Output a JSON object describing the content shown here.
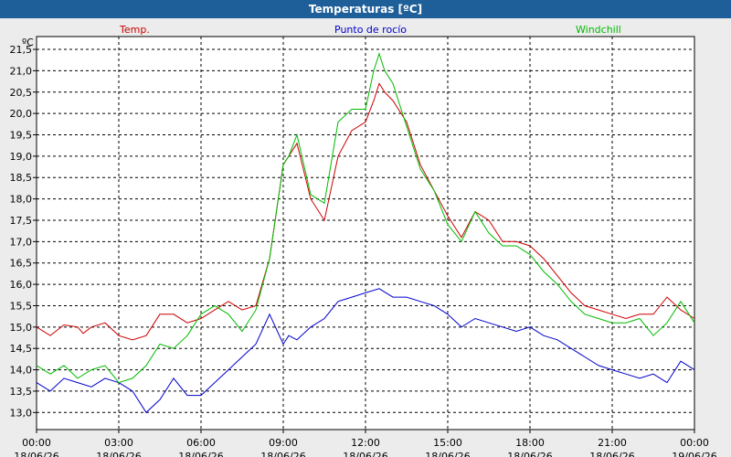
{
  "window": {
    "title": "Temperaturas [ºC]"
  },
  "colors": {
    "temp": "#cc0000",
    "dew": "#0000cc",
    "windchill": "#00bb00",
    "grid": "#000000",
    "background": "#ffffff"
  },
  "chart_data": {
    "type": "line",
    "unit_label": "ºC",
    "ylim": [
      12.6,
      21.8
    ],
    "ticks_y": [
      "13,0",
      "13,5",
      "14,0",
      "14,5",
      "15,0",
      "15,5",
      "16,0",
      "16,5",
      "17,0",
      "17,5",
      "18,0",
      "18,5",
      "19,0",
      "19,5",
      "20,0",
      "20,5",
      "21,0",
      "21,5"
    ],
    "ticks_y_values": [
      13.0,
      13.5,
      14.0,
      14.5,
      15.0,
      15.5,
      16.0,
      16.5,
      17.0,
      17.5,
      18.0,
      18.5,
      19.0,
      19.5,
      20.0,
      20.5,
      21.0,
      21.5
    ],
    "x_hours_range": [
      0,
      24
    ],
    "ticks_x": [
      {
        "hour": 0,
        "time": "00:00",
        "date": "18/06/26"
      },
      {
        "hour": 3,
        "time": "03:00",
        "date": "18/06/26"
      },
      {
        "hour": 6,
        "time": "06:00",
        "date": "18/06/26"
      },
      {
        "hour": 9,
        "time": "09:00",
        "date": "18/06/26"
      },
      {
        "hour": 12,
        "time": "12:00",
        "date": "18/06/26"
      },
      {
        "hour": 15,
        "time": "15:00",
        "date": "18/06/26"
      },
      {
        "hour": 18,
        "time": "18:00",
        "date": "18/06/26"
      },
      {
        "hour": 21,
        "time": "21:00",
        "date": "18/06/26"
      },
      {
        "hour": 24,
        "time": "00:00",
        "date": "19/06/26"
      }
    ],
    "grid": true,
    "legend_placement": "top",
    "series": [
      {
        "name": "Temp.",
        "color": "#cc0000",
        "x": [
          0,
          0.5,
          1,
          1.5,
          1.7,
          2,
          2.5,
          3,
          3.5,
          4,
          4.5,
          5,
          5.5,
          6,
          6.5,
          7,
          7.5,
          8,
          8.5,
          9,
          9.2,
          9.5,
          10,
          10.5,
          11,
          11.5,
          12,
          12.3,
          12.5,
          12.7,
          13,
          13.5,
          14,
          14.5,
          15,
          15.5,
          16,
          16.5,
          17,
          17.5,
          18,
          18.5,
          19,
          19.5,
          20,
          20.5,
          21,
          21.5,
          22,
          22.5,
          23,
          23.5,
          24
        ],
        "values": [
          15.0,
          14.8,
          15.05,
          15.0,
          14.85,
          15.0,
          15.1,
          14.8,
          14.7,
          14.8,
          15.3,
          15.3,
          15.1,
          15.2,
          15.4,
          15.6,
          15.4,
          15.5,
          16.6,
          18.8,
          19.0,
          19.3,
          18.0,
          17.5,
          19.0,
          19.6,
          19.8,
          20.3,
          20.7,
          20.5,
          20.3,
          19.8,
          18.8,
          18.2,
          17.6,
          17.1,
          17.7,
          17.5,
          17.0,
          17.0,
          16.9,
          16.6,
          16.2,
          15.8,
          15.5,
          15.4,
          15.3,
          15.2,
          15.3,
          15.3,
          15.7,
          15.4,
          15.2
        ]
      },
      {
        "name": "Punto de rocío",
        "color": "#0000cc",
        "x": [
          0,
          0.5,
          1,
          1.5,
          2,
          2.5,
          3,
          3.5,
          4,
          4.5,
          5,
          5.5,
          6,
          6.5,
          7,
          7.5,
          8,
          8.5,
          9,
          9.2,
          9.5,
          10,
          10.5,
          11,
          11.5,
          12,
          12.5,
          13,
          13.5,
          14,
          14.5,
          15,
          15.5,
          16,
          16.5,
          17,
          17.5,
          18,
          18.5,
          19,
          19.5,
          20,
          20.5,
          21,
          21.5,
          22,
          22.5,
          23,
          23.5,
          24
        ],
        "values": [
          13.7,
          13.5,
          13.8,
          13.7,
          13.6,
          13.8,
          13.7,
          13.5,
          13.0,
          13.3,
          13.8,
          13.4,
          13.4,
          13.7,
          14.0,
          14.3,
          14.6,
          15.3,
          14.6,
          14.8,
          14.7,
          15.0,
          15.2,
          15.6,
          15.7,
          15.8,
          15.9,
          15.7,
          15.7,
          15.6,
          15.5,
          15.3,
          15.0,
          15.2,
          15.1,
          15.0,
          14.9,
          15.0,
          14.8,
          14.7,
          14.5,
          14.3,
          14.1,
          14.0,
          13.9,
          13.8,
          13.9,
          13.7,
          14.2,
          14.0
        ]
      },
      {
        "name": "Windchill",
        "color": "#00bb00",
        "x": [
          0,
          0.5,
          1,
          1.5,
          2,
          2.5,
          3,
          3.5,
          4,
          4.5,
          5,
          5.5,
          6,
          6.5,
          7,
          7.5,
          8,
          8.5,
          9,
          9.2,
          9.5,
          10,
          10.5,
          11,
          11.5,
          12,
          12.3,
          12.5,
          12.7,
          13,
          13.5,
          14,
          14.5,
          15,
          15.5,
          16,
          16.5,
          17,
          17.5,
          18,
          18.5,
          19,
          19.5,
          20,
          20.5,
          21,
          21.5,
          22,
          22.5,
          23,
          23.5,
          24
        ],
        "values": [
          14.1,
          13.9,
          14.1,
          13.8,
          14.0,
          14.1,
          13.7,
          13.8,
          14.1,
          14.6,
          14.5,
          14.8,
          15.3,
          15.5,
          15.3,
          14.9,
          15.4,
          16.6,
          18.8,
          19.0,
          19.5,
          18.1,
          17.9,
          19.8,
          20.1,
          20.1,
          21.0,
          21.4,
          21.0,
          20.7,
          19.7,
          18.7,
          18.2,
          17.4,
          17.0,
          17.7,
          17.2,
          16.9,
          16.9,
          16.7,
          16.3,
          16.0,
          15.6,
          15.3,
          15.2,
          15.1,
          15.1,
          15.2,
          14.8,
          15.1,
          15.6,
          15.1
        ]
      }
    ]
  }
}
